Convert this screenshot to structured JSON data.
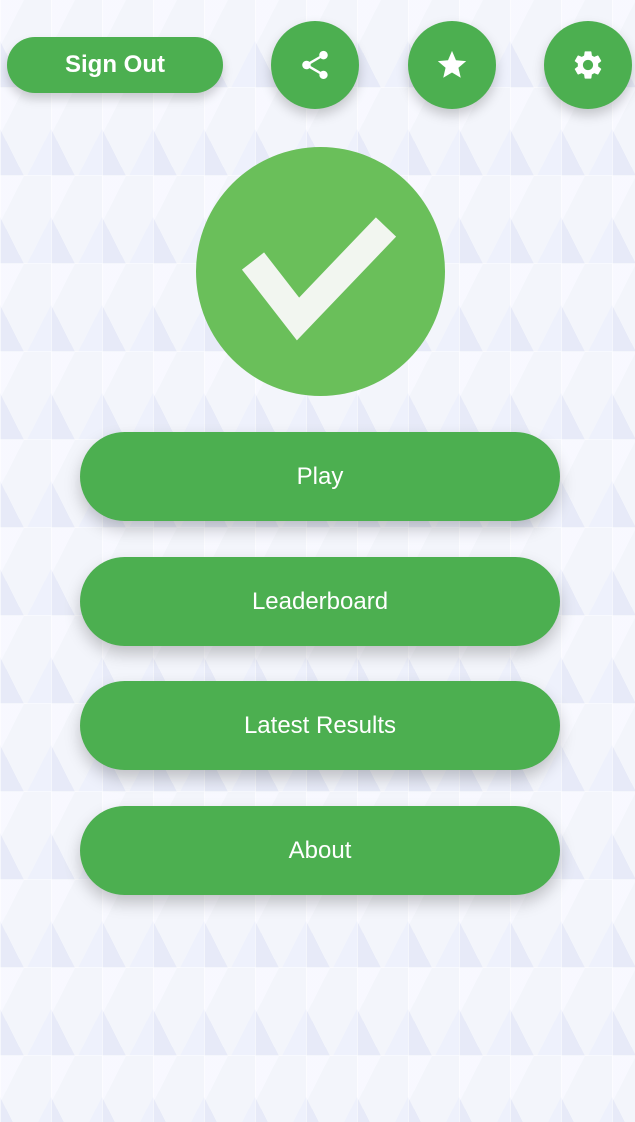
{
  "header": {
    "sign_out_label": "Sign Out",
    "share_icon": "share-icon",
    "star_icon": "star-icon",
    "settings_icon": "gear-icon"
  },
  "logo": {
    "icon": "checkmark-icon",
    "color": "#6abf5a"
  },
  "menu": {
    "items": [
      {
        "label": "Play"
      },
      {
        "label": "Leaderboard"
      },
      {
        "label": "Latest Results"
      },
      {
        "label": "About"
      }
    ]
  },
  "theme": {
    "accent": "#4caf50",
    "text_on_accent": "#ffffff"
  }
}
